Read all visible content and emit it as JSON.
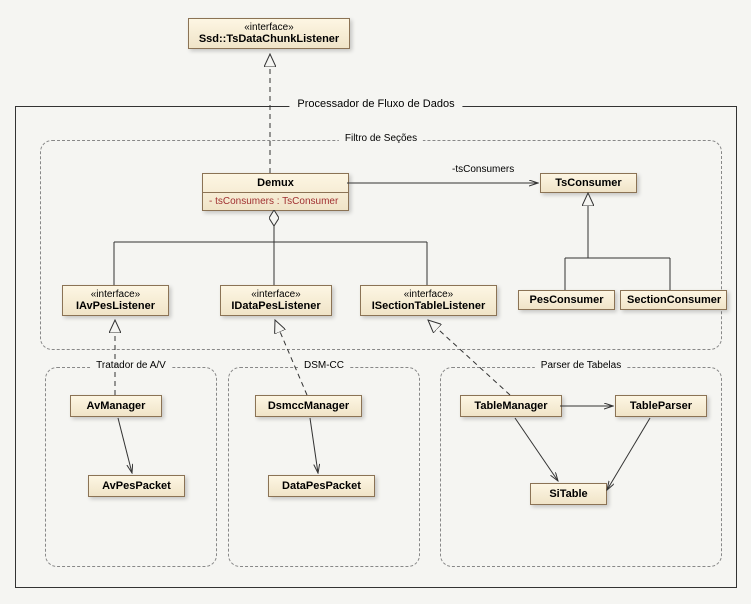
{
  "top_interface": {
    "stereotype": "«interface»",
    "name": "Ssd::TsDataChunkListener"
  },
  "outer_frame_title": "Processador de Fluxo de Dados",
  "filtro_frame_title": "Filtro de Seções",
  "demux": {
    "name": "Demux",
    "attr": "- tsConsumers : TsConsumer"
  },
  "tsconsumer": {
    "name": "TsConsumer"
  },
  "tsconsumer_assoc": "-tsConsumers",
  "iav": {
    "stereotype": "«interface»",
    "name": "IAvPesListener"
  },
  "idata": {
    "stereotype": "«interface»",
    "name": "IDataPesListener"
  },
  "isection": {
    "stereotype": "«interface»",
    "name": "ISectionTableListener"
  },
  "pesconsumer": {
    "name": "PesConsumer"
  },
  "sectionconsumer": {
    "name": "SectionConsumer"
  },
  "tratador_title": "Tratador de A/V",
  "dsmcc_title": "DSM-CC",
  "parser_title": "Parser de Tabelas",
  "avmanager": {
    "name": "AvManager"
  },
  "avpespacket": {
    "name": "AvPesPacket"
  },
  "dsmccmanager": {
    "name": "DsmccManager"
  },
  "datapespacket": {
    "name": "DataPesPacket"
  },
  "tablemanager": {
    "name": "TableManager"
  },
  "tableparser": {
    "name": "TableParser"
  },
  "sitable": {
    "name": "SiTable"
  }
}
